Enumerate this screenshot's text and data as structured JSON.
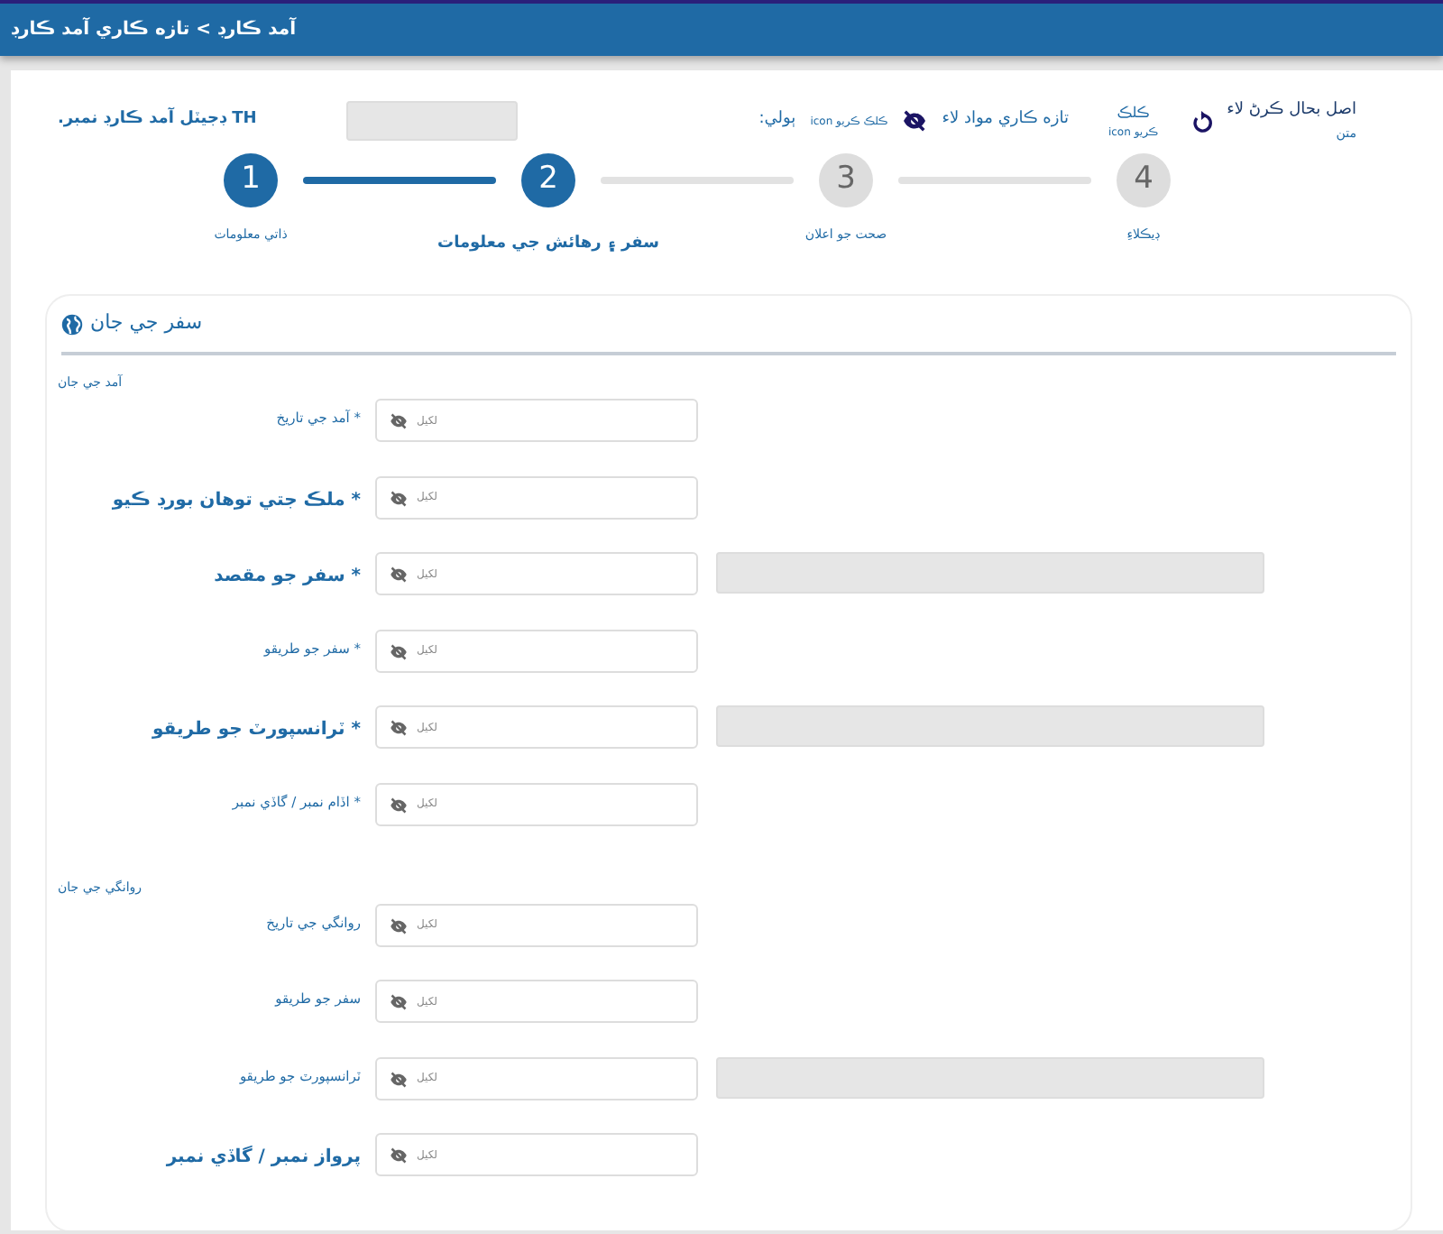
{
  "header": {
    "breadcrumb": "آمد ڪارڊ > تازه ڪاري آمد ڪارڊ"
  },
  "toolbar": {
    "card_number_label": "TH ڊجيٽل آمد ڪارڊ نمبر.",
    "card_number_disabled": true,
    "language_label": "ٻولي:",
    "refresh": {
      "hint": "ڪلڪ ڪريو icon",
      "label": "تازه ڪاري مواد لاء"
    },
    "reset": {
      "hint_top": "ڪلڪ",
      "hint_bottom": "ڪريو icon",
      "label": "اصل بحال ڪرڻ لاء",
      "label_bottom": "متن"
    }
  },
  "steps": [
    {
      "number": "4",
      "label": "ڊيڪلاءِ",
      "completed": false,
      "selected": false
    },
    {
      "number": "3",
      "label": "صحت جو اعلان",
      "completed": false,
      "selected": false
    },
    {
      "number": "2",
      "label": "سفر ۽ رهائش جي معلومات",
      "completed": true,
      "selected": true
    },
    {
      "number": "1",
      "label": "ذاتي معلومات",
      "completed": true,
      "selected": false
    }
  ],
  "card": {
    "title": "سفر جي جان",
    "sections": [
      {
        "title": "آمد جي جان",
        "rows": [
          {
            "label": "* آمد جي تاريخ",
            "large": false,
            "placeholder": "لکيل",
            "extra_field": false
          },
          {
            "label": "* ملڪ جتي توهان بورڊ ڪيو",
            "large": true,
            "placeholder": "لکيل",
            "extra_field": false
          },
          {
            "label": "* سفر جو مقصد",
            "large": true,
            "placeholder": "لکيل",
            "extra_field": true
          },
          {
            "label": "* سفر جو طريقو",
            "large": false,
            "placeholder": "لکيل",
            "extra_field": false
          },
          {
            "label": "* ٽرانسپورٽ جو طريقو",
            "large": true,
            "placeholder": "لکيل",
            "extra_field": true
          },
          {
            "label": "* اڏام نمبر / گاڏي نمبر",
            "large": false,
            "placeholder": "لکيل",
            "extra_field": false
          }
        ]
      },
      {
        "title": "روانگي جي جان",
        "rows": [
          {
            "label": "روانگي جي تاريخ",
            "large": false,
            "placeholder": "لکيل",
            "extra_field": false
          },
          {
            "label": "سفر جو طريقو",
            "large": false,
            "placeholder": "لکيل",
            "extra_field": false
          },
          {
            "label": "ٽرانسپورٽ جو طريقو",
            "large": false,
            "placeholder": "لکيل",
            "extra_field": true
          },
          {
            "label": "پرواز نمبر / گاڏي نمبر",
            "large": true,
            "placeholder": "لکيل",
            "extra_field": false
          }
        ]
      }
    ]
  }
}
